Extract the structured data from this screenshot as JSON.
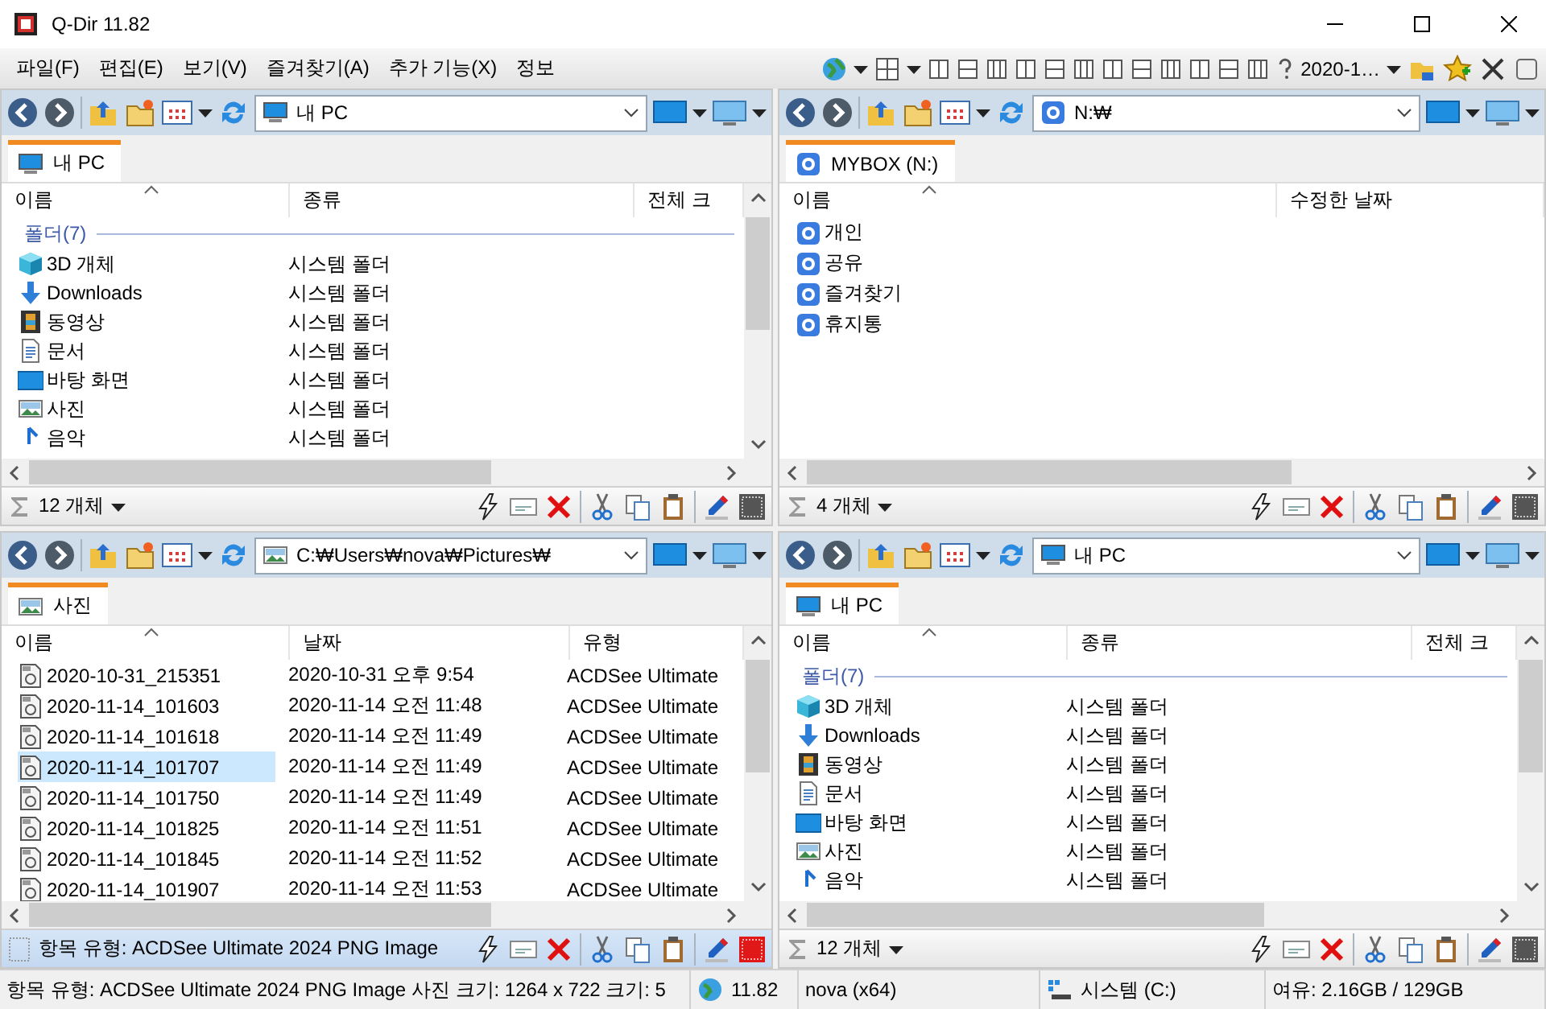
{
  "window": {
    "title": "Q-Dir 11.82"
  },
  "menu": [
    "파일(F)",
    "편집(E)",
    "보기(V)",
    "즐겨찾기(A)",
    "추가 기능(X)",
    "정보"
  ],
  "toolbar": {
    "preset": "2020-1…"
  },
  "panes": [
    {
      "active": false,
      "address": {
        "kind": "pc",
        "text": "내 PC"
      },
      "tabs": [
        {
          "kind": "pc",
          "label": "내 PC",
          "selected": true
        }
      ],
      "columns": [
        "이름",
        "종류",
        "전체 크"
      ],
      "group": "폴더(7)",
      "vertical_scrollbar": true,
      "rows": [
        {
          "kind": "cube",
          "cells": [
            "3D 개체",
            "시스템 폴더"
          ],
          "selected": false
        },
        {
          "kind": "download",
          "cells": [
            "Downloads",
            "시스템 폴더"
          ],
          "selected": false
        },
        {
          "kind": "video",
          "cells": [
            "동영상",
            "시스템 폴더"
          ],
          "selected": false
        },
        {
          "kind": "document",
          "cells": [
            "문서",
            "시스템 폴더"
          ],
          "selected": false
        },
        {
          "kind": "desktop",
          "cells": [
            "바탕 화면",
            "시스템 폴더"
          ],
          "selected": false
        },
        {
          "kind": "picture",
          "cells": [
            "사진",
            "시스템 폴더"
          ],
          "selected": false
        },
        {
          "kind": "music",
          "cells": [
            "음악",
            "시스템 폴더"
          ],
          "selected": false
        }
      ],
      "footer": {
        "kind": "count",
        "text": "12 개체"
      }
    },
    {
      "active": false,
      "address": {
        "kind": "mybox",
        "text": "N:₩"
      },
      "tabs": [
        {
          "kind": "mybox",
          "label": "MYBOX (N:)",
          "selected": true
        }
      ],
      "columns": [
        "이름",
        "수정한 날짜"
      ],
      "vertical_scrollbar": false,
      "rows": [
        {
          "kind": "mybox",
          "cells": [
            "개인"
          ],
          "selected": false
        },
        {
          "kind": "mybox",
          "cells": [
            "공유"
          ],
          "selected": false
        },
        {
          "kind": "mybox",
          "cells": [
            "즐겨찾기"
          ],
          "selected": false
        },
        {
          "kind": "mybox",
          "cells": [
            "휴지통"
          ],
          "selected": false
        }
      ],
      "footer": {
        "kind": "count",
        "text": "4 개체"
      }
    },
    {
      "active": true,
      "address": {
        "kind": "picture",
        "text": "C:₩Users₩nova₩Pictures₩"
      },
      "tabs": [
        {
          "kind": "picture",
          "label": "사진",
          "selected": true
        }
      ],
      "columns": [
        "이름",
        "날짜",
        "유형"
      ],
      "vertical_scrollbar": true,
      "rows": [
        {
          "kind": "png",
          "cells": [
            "2020-10-31_215351",
            "2020-10-31 오후 9:54",
            "ACDSee Ultimate"
          ],
          "selected": false
        },
        {
          "kind": "png",
          "cells": [
            "2020-11-14_101603",
            "2020-11-14 오전 11:48",
            "ACDSee Ultimate"
          ],
          "selected": false
        },
        {
          "kind": "png",
          "cells": [
            "2020-11-14_101618",
            "2020-11-14 오전 11:49",
            "ACDSee Ultimate"
          ],
          "selected": false
        },
        {
          "kind": "png",
          "cells": [
            "2020-11-14_101707",
            "2020-11-14 오전 11:49",
            "ACDSee Ultimate"
          ],
          "selected": true
        },
        {
          "kind": "png",
          "cells": [
            "2020-11-14_101750",
            "2020-11-14 오전 11:49",
            "ACDSee Ultimate"
          ],
          "selected": false
        },
        {
          "kind": "png",
          "cells": [
            "2020-11-14_101825",
            "2020-11-14 오전 11:51",
            "ACDSee Ultimate"
          ],
          "selected": false
        },
        {
          "kind": "png",
          "cells": [
            "2020-11-14_101845",
            "2020-11-14 오전 11:52",
            "ACDSee Ultimate"
          ],
          "selected": false
        },
        {
          "kind": "png",
          "cells": [
            "2020-11-14_101907",
            "2020-11-14 오전 11:53",
            "ACDSee Ultimate"
          ],
          "selected": false
        }
      ],
      "footer": {
        "kind": "info",
        "text": "항목 유형: ACDSee Ultimate 2024 PNG Image"
      }
    },
    {
      "active": false,
      "address": {
        "kind": "pc",
        "text": "내 PC"
      },
      "tabs": [
        {
          "kind": "pc",
          "label": "내 PC",
          "selected": true
        }
      ],
      "columns": [
        "이름",
        "종류",
        "전체 크"
      ],
      "group": "폴더(7)",
      "vertical_scrollbar": true,
      "rows": [
        {
          "kind": "cube",
          "cells": [
            "3D 개체",
            "시스템 폴더"
          ],
          "selected": false
        },
        {
          "kind": "download",
          "cells": [
            "Downloads",
            "시스템 폴더"
          ],
          "selected": false
        },
        {
          "kind": "video",
          "cells": [
            "동영상",
            "시스템 폴더"
          ],
          "selected": false
        },
        {
          "kind": "document",
          "cells": [
            "문서",
            "시스템 폴더"
          ],
          "selected": false
        },
        {
          "kind": "desktop",
          "cells": [
            "바탕 화면",
            "시스템 폴더"
          ],
          "selected": false
        },
        {
          "kind": "picture",
          "cells": [
            "사진",
            "시스템 폴더"
          ],
          "selected": false
        },
        {
          "kind": "music",
          "cells": [
            "음악",
            "시스템 폴더"
          ],
          "selected": false
        }
      ],
      "footer": {
        "kind": "count",
        "text": "12 개체"
      }
    }
  ],
  "status_bar": {
    "info": "항목 유형: ACDSee Ultimate 2024 PNG Image 사진 크기: 1264 x 722 크기: 5",
    "version": "11.82",
    "user": "nova (x64)",
    "drive": "시스템 (C:)",
    "free": "여유: 2.16GB / 129GB"
  }
}
